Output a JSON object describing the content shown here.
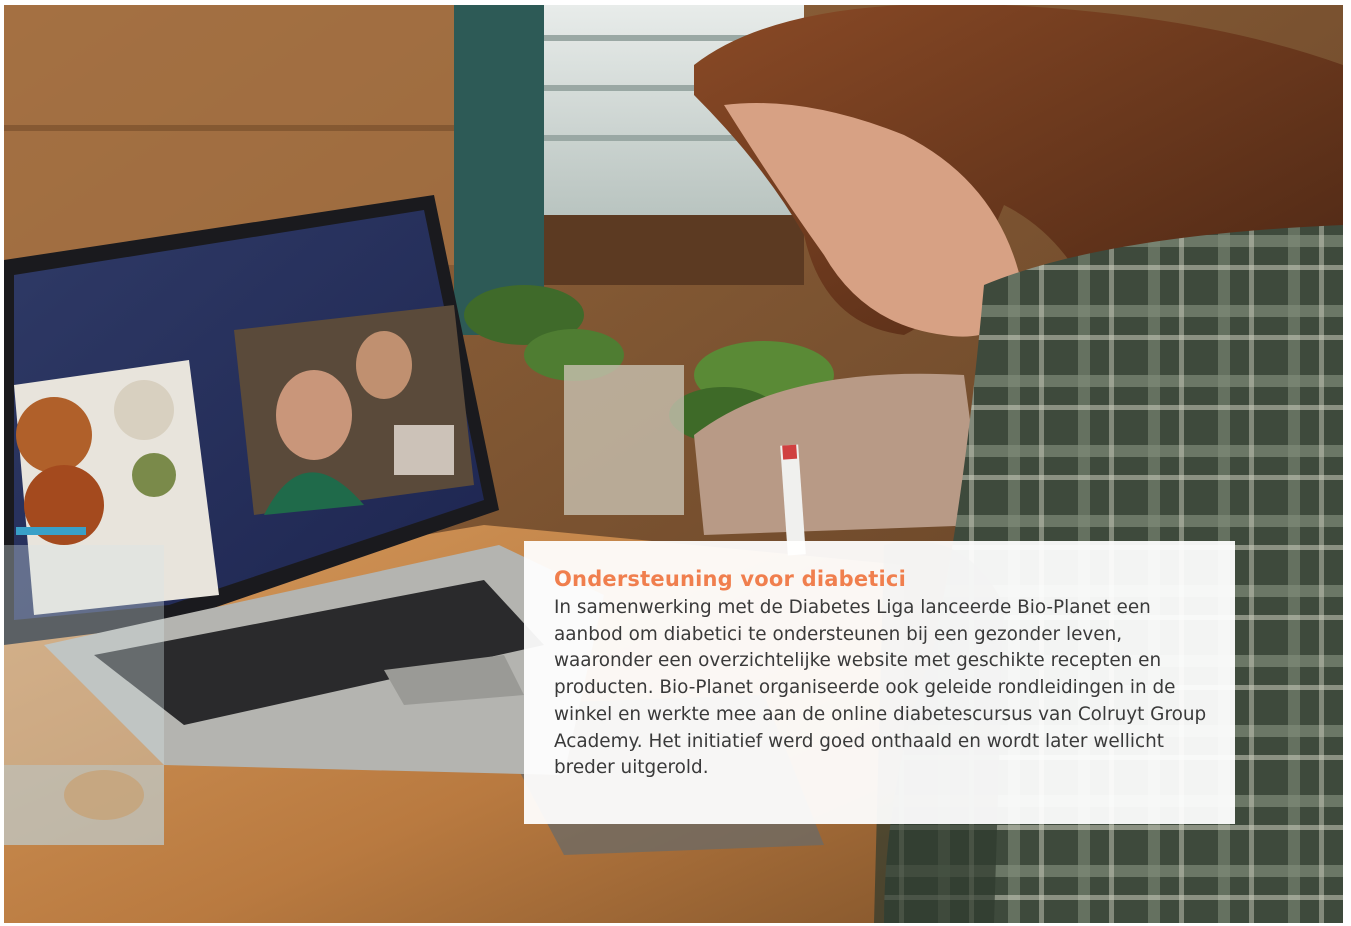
{
  "photo": {
    "subject": "person-writing-notes-beside-laptop-video-call"
  },
  "caption": {
    "title": "Ondersteuning voor diabetici",
    "body": "In samenwerking met de Diabetes Liga lanceerde Bio-Planet een aanbod om diabetici te ondersteunen bij een gezonder leven, waaronder een overzichtelijke website met geschikte recepten en producten. Bio-Planet organiseerde ook geleide rondleidingen in de winkel en werkte mee aan de online diabetescursus van Colruyt Group Academy. Het initiatief werd goed onthaald en wordt later wellicht breder uitgerold."
  },
  "colors": {
    "title_accent": "#f07f4e",
    "body_text": "#3a3a3a",
    "caption_background": "#ffffff"
  }
}
